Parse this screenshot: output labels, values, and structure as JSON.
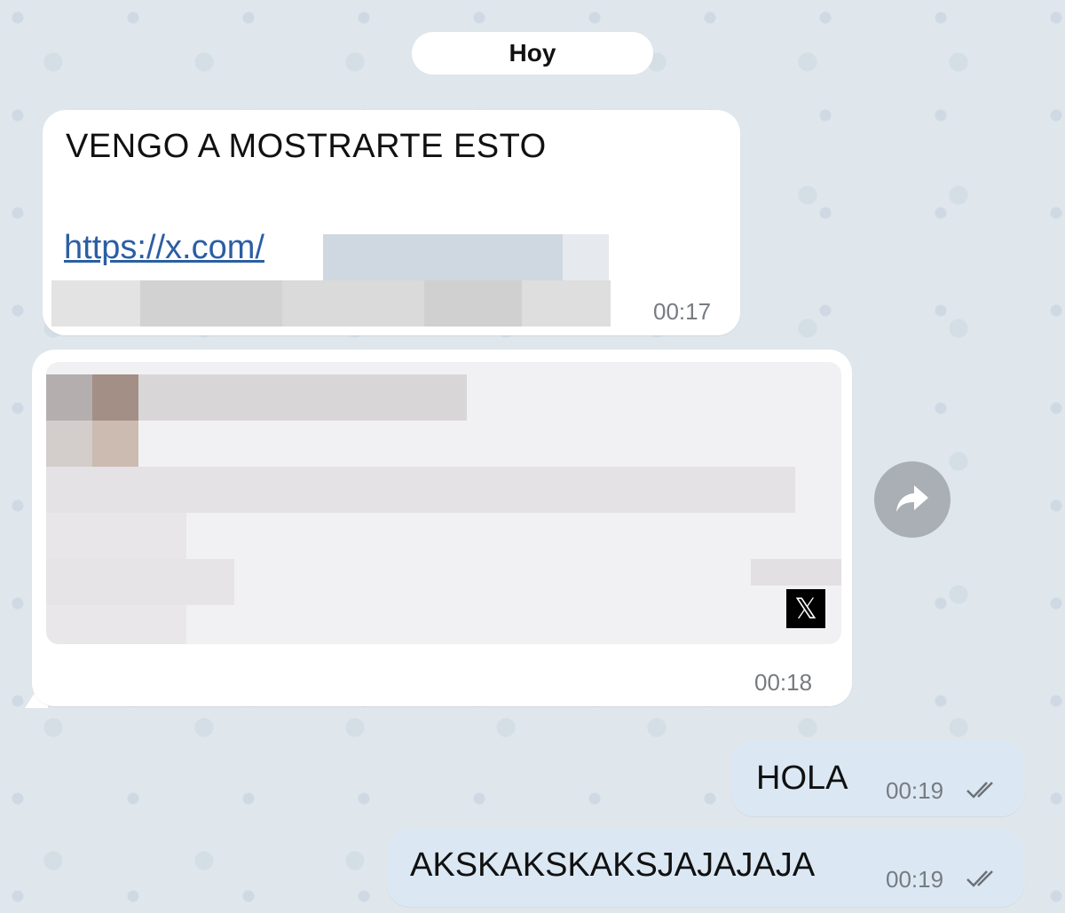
{
  "date_separator": "Hoy",
  "messages": [
    {
      "direction": "incoming",
      "text": "VENGO A MOSTRARTE ESTO",
      "link_text": "https://x.com/",
      "time": "00:17"
    },
    {
      "direction": "incoming",
      "preview_source_icon": "x-logo-icon",
      "preview_source_glyph": "𝕏",
      "time": "00:18"
    },
    {
      "direction": "outgoing",
      "text": "HOLA",
      "time": "00:19",
      "status_icon": "double-check-icon"
    },
    {
      "direction": "outgoing",
      "text": "AKSKAKSKAKSJAJAJAJA",
      "time": "00:19",
      "status_icon": "double-check-icon"
    }
  ],
  "share_button_icon": "share-arrow-icon",
  "colors": {
    "background": "#dfe6ec",
    "incoming_bubble": "#ffffff",
    "outgoing_bubble": "#dbe8f4",
    "link": "#2b5ea3",
    "timestamp": "#777b80",
    "share_button": "#a9afb5"
  }
}
